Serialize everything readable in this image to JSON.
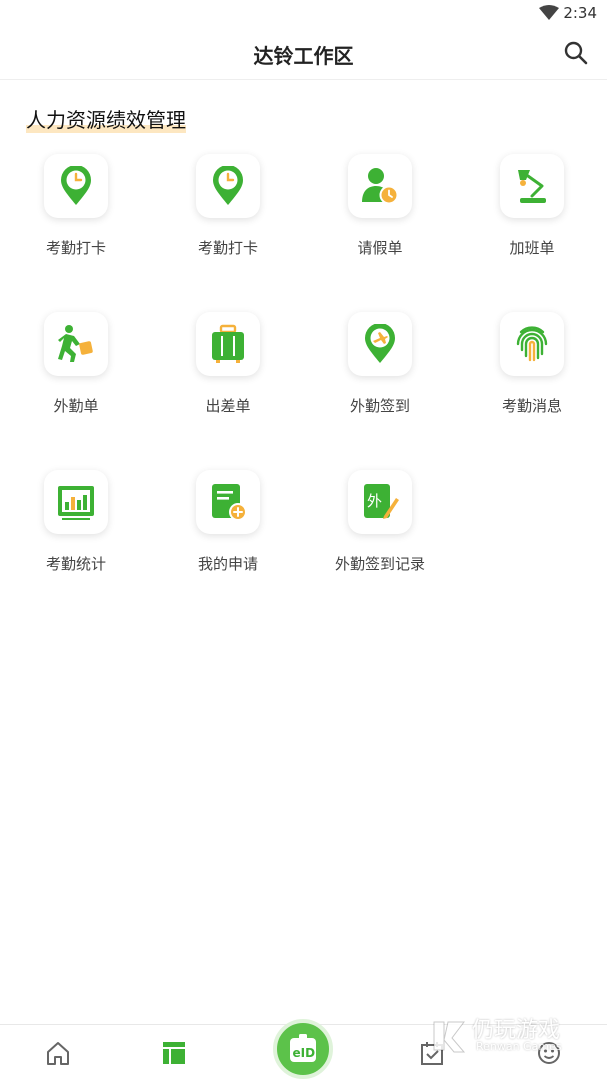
{
  "status_bar": {
    "time": "2:34"
  },
  "header": {
    "title": "达铃工作区"
  },
  "section": {
    "title": "人力资源绩效管理"
  },
  "grid_items": [
    {
      "label": "考勤打卡",
      "icon": "location-clock-icon"
    },
    {
      "label": "考勤打卡",
      "icon": "location-clock-icon"
    },
    {
      "label": "请假单",
      "icon": "user-clock-icon"
    },
    {
      "label": "加班单",
      "icon": "desk-lamp-icon"
    },
    {
      "label": "外勤单",
      "icon": "walking-person-icon"
    },
    {
      "label": "出差单",
      "icon": "suitcase-icon"
    },
    {
      "label": "外勤签到",
      "icon": "location-plane-icon"
    },
    {
      "label": "考勤消息",
      "icon": "fingerprint-icon"
    },
    {
      "label": "考勤统计",
      "icon": "bar-chart-icon"
    },
    {
      "label": "我的申请",
      "icon": "document-add-icon"
    },
    {
      "label": "外勤签到记录",
      "icon": "outside-sign-icon"
    }
  ],
  "bottom_nav": {
    "items": [
      "home-icon",
      "workspace-icon",
      "eid-icon",
      "checklist-icon",
      "profile-icon"
    ],
    "center_label": "eID"
  },
  "watermark": {
    "title": "仍玩游戏",
    "subtitle": "Renwan Games"
  },
  "colors": {
    "accent_green": "#3db134",
    "accent_orange": "#f5b13b",
    "highlight": "#fde7c1"
  }
}
